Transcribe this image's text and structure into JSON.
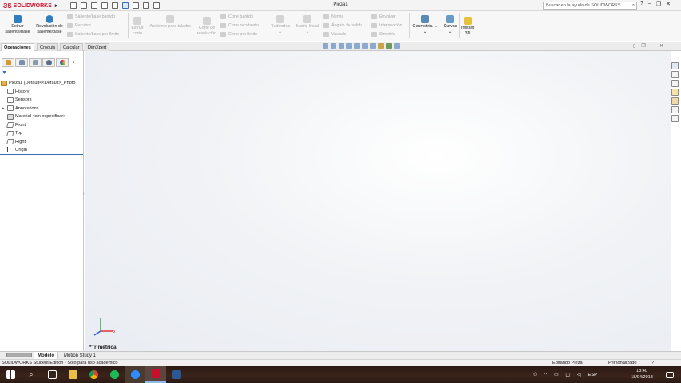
{
  "app": {
    "brand": "SOLIDWORKS",
    "document_title": "Pieza1"
  },
  "search": {
    "placeholder": "Buscar en la ayuda de SOLIDWORKS"
  },
  "window_controls": {
    "help": "?",
    "minimize": "–",
    "restore": "❐",
    "close": "✕"
  },
  "command_manager": {
    "extrude_boss": "Extruir saliente/base",
    "revolve_boss": "Revolución de saliente/base",
    "swept_boss": "Saliente/base barrido",
    "lofted_boss": "Recubrir",
    "boundary_boss": "Saliente/base por límite",
    "extruded_cut": "Extruir corte",
    "hole_wizard": "Asistente para taladro",
    "revolved_cut": "Corte de revolución",
    "swept_cut": "Corte barrido",
    "lofted_cut": "Corte recubierto",
    "boundary_cut": "Corte por límite",
    "fillet": "Redondeo",
    "linear_pattern": "Matriz lineal",
    "rib": "Nervio",
    "draft": "Ángulo de salida",
    "shell": "Vaciado",
    "wrap": "Envolver",
    "intersect": "Intersección",
    "mirror": "Simetría",
    "ref_geometry": "Geometría ...",
    "curves": "Curvas",
    "instant3d": "Instant 3D"
  },
  "tabs": [
    "Operaciones",
    "Croquis",
    "Calcular",
    "DimXpert"
  ],
  "feature_tree": {
    "root": "Pieza1  (Default<<Default>_Photo",
    "items": [
      "History",
      "Sensors",
      "Annotations",
      "Material <sin especificar>",
      "Front",
      "Top",
      "Right",
      "Origin"
    ]
  },
  "viewport": {
    "view_name": "*Trimétrica"
  },
  "bottom_tabs": [
    "Modelo",
    "Motion Study 1"
  ],
  "status_bar": {
    "left": "SOLIDWORKS Student Edition - Sólo para uso académico",
    "mode": "Editando Pieza",
    "units": "Personalizado"
  },
  "taskbar": {
    "language": "ESP",
    "time": "18:40",
    "date": "18/04/2018"
  },
  "colors": {
    "brand_red": "#c8102e",
    "accent_blue": "#3b6fb5",
    "taskbar": "#2b1a14"
  }
}
